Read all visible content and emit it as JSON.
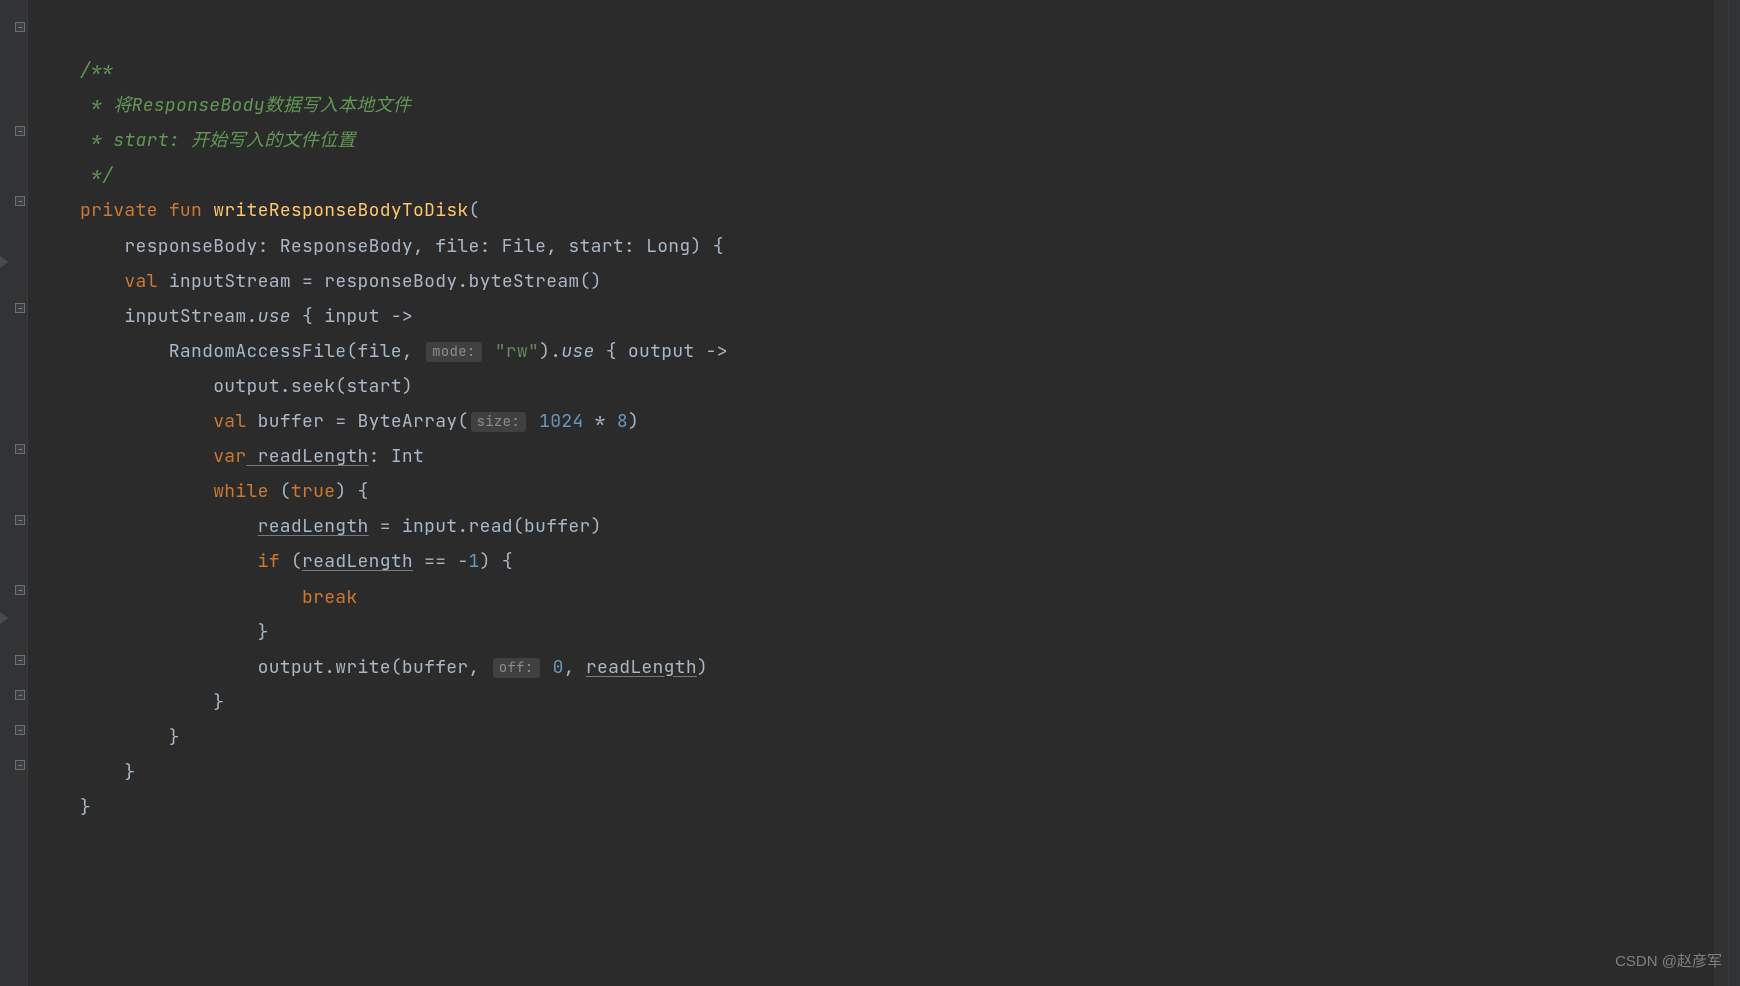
{
  "code": {
    "l1": "/**",
    "l2_a": " * ",
    "l2_b": "将ResponseBody数据写入本地文件",
    "l3_a": " * start: ",
    "l3_b": "开始写入的文件位置",
    "l4": " */",
    "l5_private": "private",
    "l5_fun": "fun",
    "l5_name": "writeResponseBodyToDisk",
    "l5_open": "(",
    "l6": "    responseBody: ResponseBody, file: File, start: Long) {",
    "l7_val": "val",
    "l7_rest": " inputStream = responseBody.byteStream()",
    "l8_a": "    inputStream.",
    "l8_use": "use",
    "l8_b": " { input ->",
    "l9_a": "        RandomAccessFile(file, ",
    "l9_hint_mode": "mode:",
    "l9_str": " \"rw\"",
    "l9_b": ").",
    "l9_use": "use",
    "l9_c": " { output ->",
    "l10": "            output.seek(start)",
    "l11_val": "val",
    "l11_a": " buffer = ByteArray(",
    "l11_hint_size": "size:",
    "l11_num": " 1024",
    "l11_b": " * ",
    "l11_num2": "8",
    "l11_c": ")",
    "l12_var": "var",
    "l12_rl": " readLength",
    "l12_b": ": Int",
    "l13_while": "while",
    "l13_a": " (",
    "l13_true": "true",
    "l13_b": ") {",
    "l14_rl": "readLength",
    "l14_b": " = input.read(buffer)",
    "l15_if": "if",
    "l15_a": " (",
    "l15_rl": "readLength",
    "l15_b": " == -",
    "l15_num": "1",
    "l15_c": ") {",
    "l16_break": "break",
    "l17": "                }",
    "l18_a": "                output.write(buffer, ",
    "l18_hint_off": "off:",
    "l18_num": " 0",
    "l18_b": ", ",
    "l18_rl": "readLength",
    "l18_c": ")",
    "l19": "            }",
    "l20": "        }",
    "l21": "    }",
    "l22": "}"
  },
  "watermark": "CSDN @赵彦军"
}
